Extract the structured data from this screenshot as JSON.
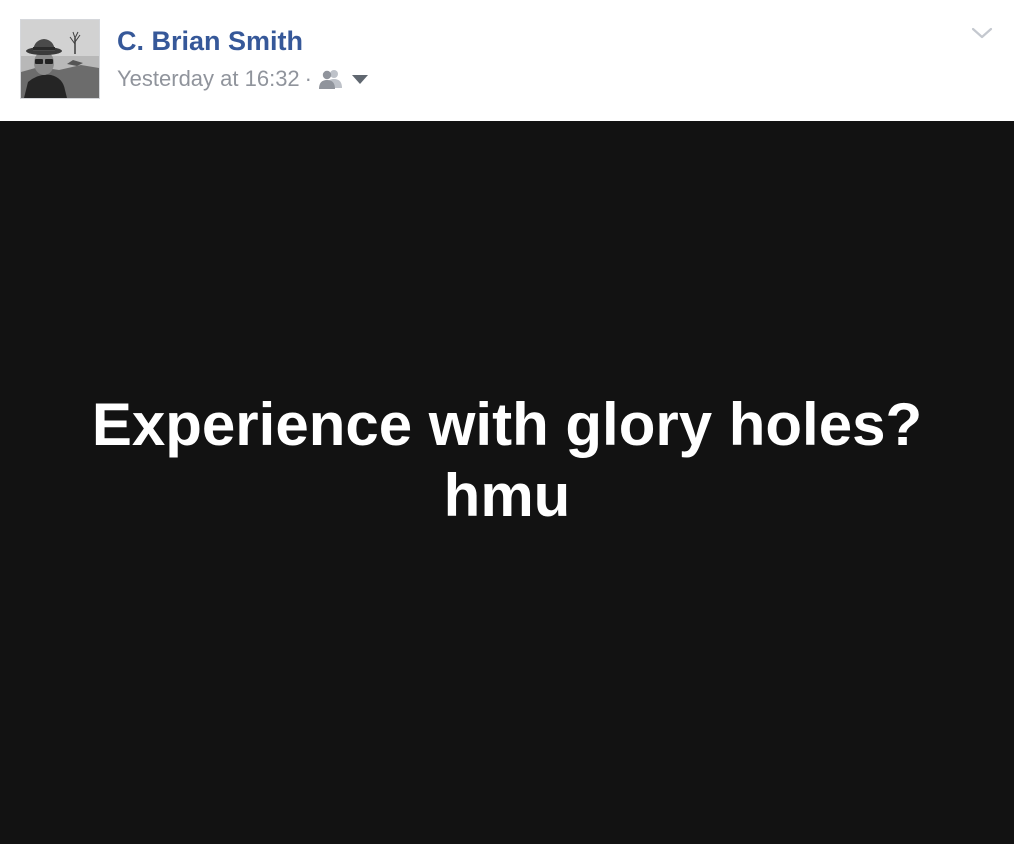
{
  "post": {
    "author": {
      "name": "C. Brian Smith",
      "avatar_icon": "profile-photo"
    },
    "meta": {
      "timestamp": "Yesterday at 16:32",
      "separator": "·",
      "audience_icon": "friends-icon",
      "audience_dropdown_icon": "caret-down-icon"
    },
    "menu_icon": "chevron-down-icon",
    "status": {
      "text": "Experience with glory holes? hmu",
      "background_color": "#121212",
      "text_color": "#ffffff"
    }
  },
  "colors": {
    "author_link": "#365899",
    "meta_text": "#90949c"
  }
}
